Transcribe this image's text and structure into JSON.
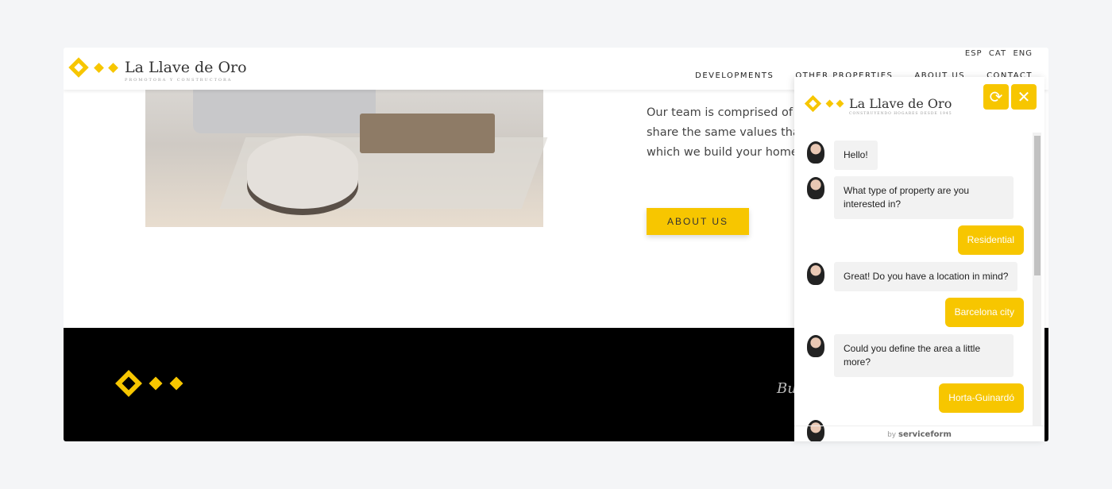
{
  "header": {
    "brand": "La Llave de Oro",
    "tagline": "PROMOTORA Y CONSTRUCTORA",
    "languages": "ESP  CAT  ENG",
    "nav": [
      "DEVELOPMENTS",
      "OTHER PROPERTIES",
      "ABOUT US",
      "CONTACT"
    ]
  },
  "about": {
    "lines": [
      "Our team is comprised of p",
      "share the same values that",
      "which we build your home."
    ],
    "button": "ABOUT US"
  },
  "footer": {
    "text": "Bu"
  },
  "chat": {
    "brand": "La Llave de Oro",
    "tagline": "CONSTRUYENDO HOGARES DESDE 1945",
    "refresh_icon": "refresh-icon",
    "close_icon": "close-icon",
    "messages": [
      {
        "from": "bot",
        "text": "Hello!"
      },
      {
        "from": "bot",
        "text": "What type of property are you interested in?"
      },
      {
        "from": "user",
        "text": "Residential"
      },
      {
        "from": "bot",
        "text": "Great! Do you have a location in mind?"
      },
      {
        "from": "user",
        "text": "Barcelona city"
      },
      {
        "from": "bot",
        "text": "Could you define the area a little more?"
      },
      {
        "from": "user",
        "text": "Horta-Guinardó"
      }
    ],
    "powered_by": "by",
    "powered_brand": "serviceform"
  },
  "colors": {
    "accent": "#f7c600",
    "footer": "#000000"
  }
}
